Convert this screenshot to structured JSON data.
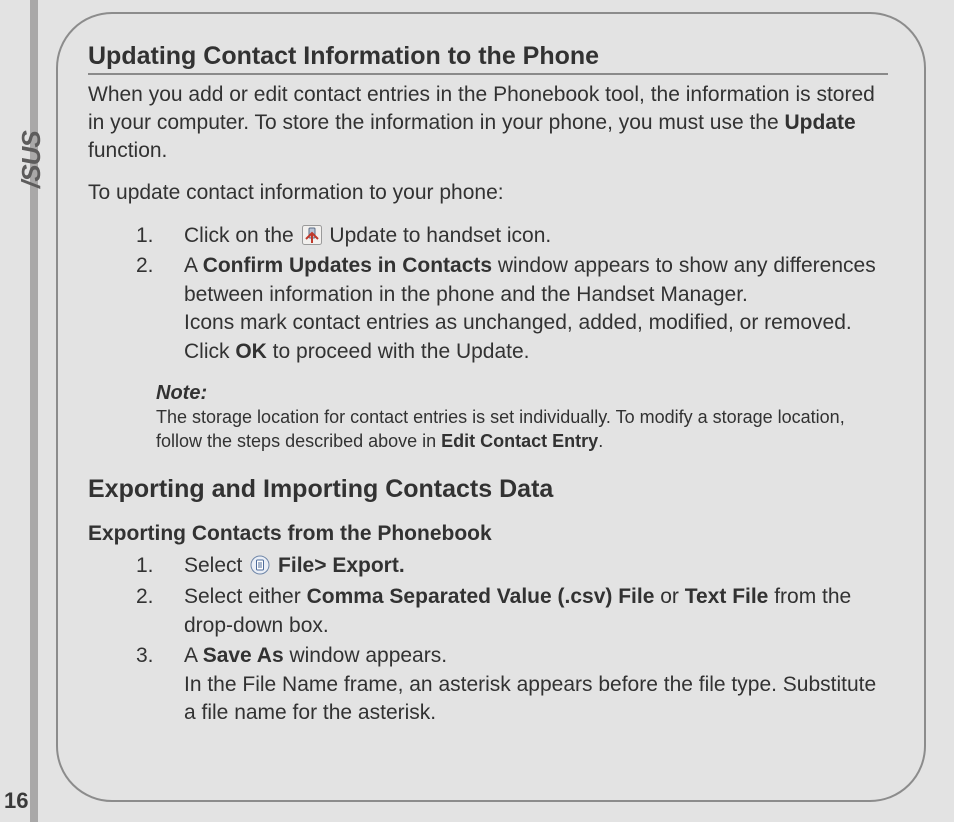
{
  "brand": "/SUS",
  "pageNumber": "16",
  "section1": {
    "title": "Updating Contact Information to the Phone",
    "intro_a": "When you add or edit contact entries in the Phonebook tool, the information is stored in your computer. To store the information in your phone, you must use the ",
    "intro_bold": "Update",
    "intro_b": " function.",
    "lead": "To update contact information to your phone:",
    "steps": {
      "n1": "1.",
      "s1a": "Click on the ",
      "s1b": " Update to handset icon.",
      "n2": "2.",
      "s2a": "A ",
      "s2bold1": "Confirm Updates in Contacts",
      "s2b": " window appears to show any differences between information in the phone and the Handset Manager.",
      "s2c": "Icons mark contact entries as unchanged, added, modified, or removed.",
      "s2d_a": "Click ",
      "s2d_bold": "OK",
      "s2d_b": " to proceed with the Update."
    },
    "note": {
      "label": "Note:",
      "text_a": "The storage location for contact entries is set individually. To modify a storage location, follow the steps described above in ",
      "text_bold": "Edit Contact Entry",
      "text_b": "."
    }
  },
  "section2": {
    "title": "Exporting and Importing Contacts Data",
    "sub1": {
      "title": "Exporting Contacts from the Phonebook",
      "n1": "1.",
      "s1a": "Select ",
      "s1bold": " File> Export.",
      "n2": "2.",
      "s2a": "Select either ",
      "s2bold1": "Comma Separated Value (.csv) File",
      "s2mid": " or ",
      "s2bold2": "Text File",
      "s2b": " from the drop-down box.",
      "n3": "3.",
      "s3a": "A ",
      "s3bold": "Save As",
      "s3b": " window appears.",
      "s3c": "In the File Name frame, an asterisk appears before the file type. Substitute a file name for the asterisk."
    }
  }
}
